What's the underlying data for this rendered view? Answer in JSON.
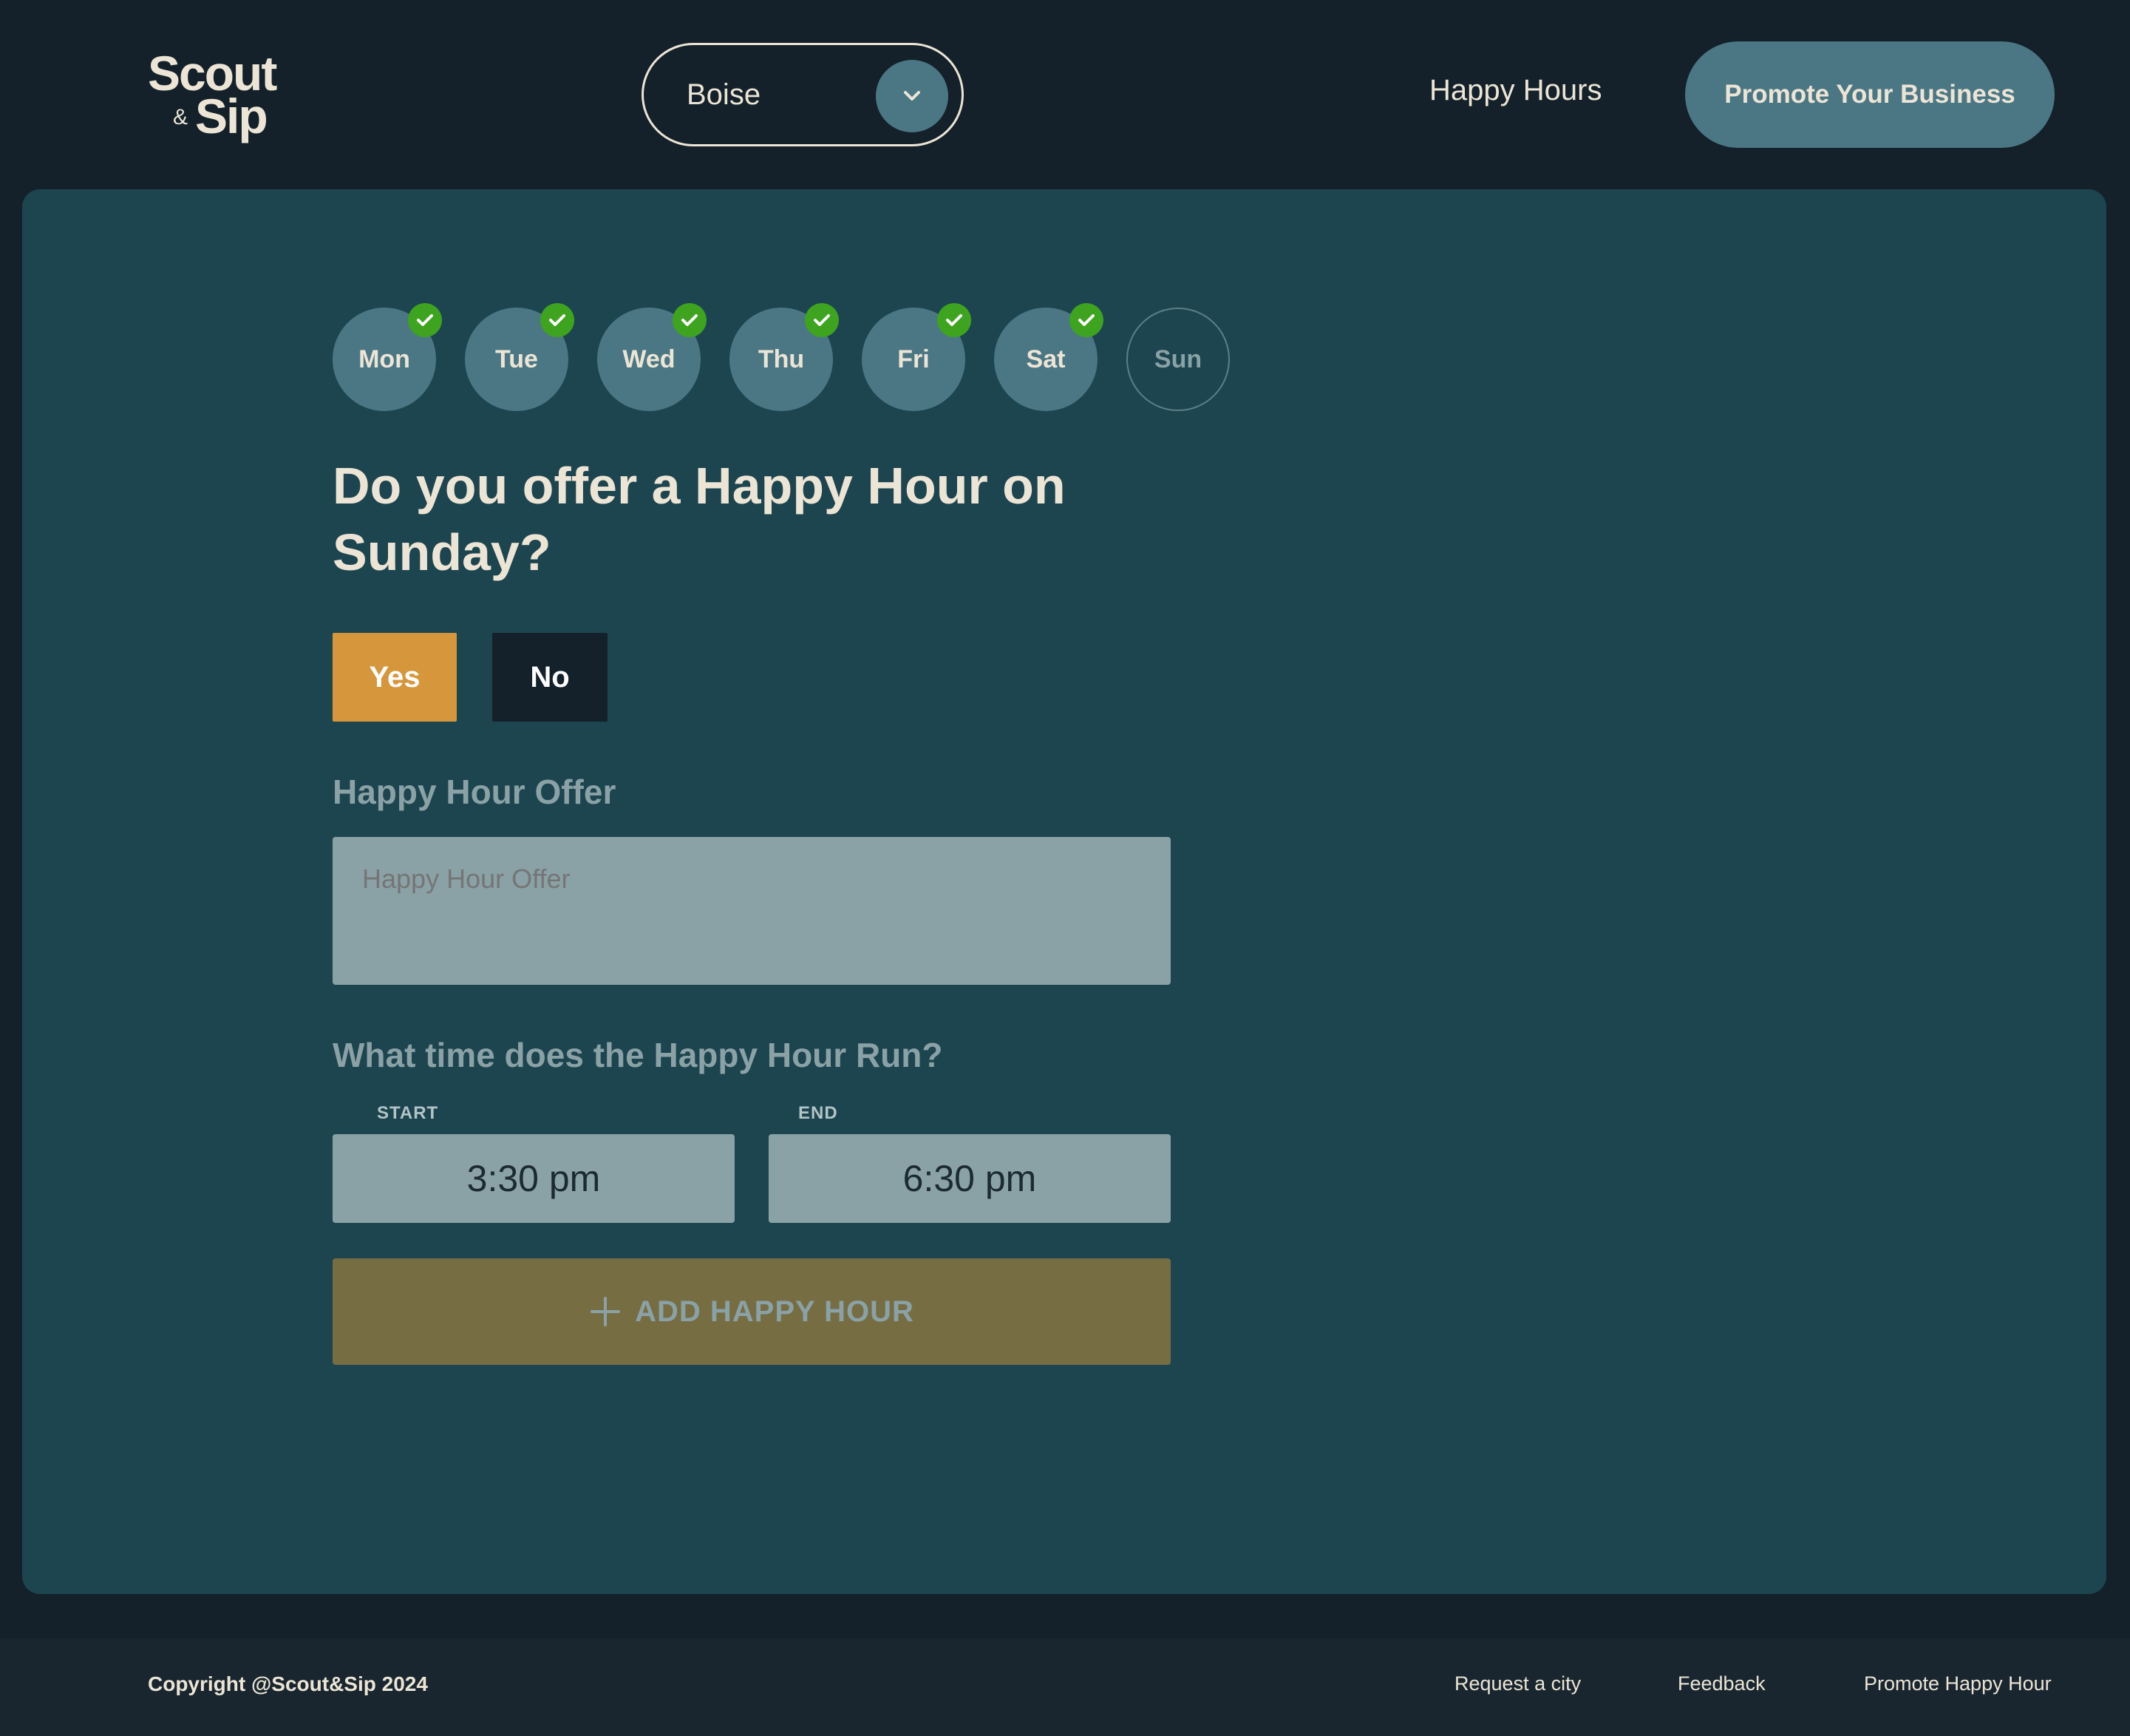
{
  "header": {
    "logo": {
      "line1": "Scout",
      "amp": "&",
      "line2": "Sip"
    },
    "city_select": {
      "value": "Boise",
      "icon": "chevron-down-icon"
    },
    "nav_link": "Happy Hours",
    "promote_button": "Promote Your Business"
  },
  "days": [
    {
      "label": "Mon",
      "done": true
    },
    {
      "label": "Tue",
      "done": true
    },
    {
      "label": "Wed",
      "done": true
    },
    {
      "label": "Thu",
      "done": true
    },
    {
      "label": "Fri",
      "done": true
    },
    {
      "label": "Sat",
      "done": true
    },
    {
      "label": "Sun",
      "done": false
    }
  ],
  "form": {
    "question": "Do you offer a Happy Hour on Sunday?",
    "yes_label": "Yes",
    "no_label": "No",
    "offer_label": "Happy Hour Offer",
    "offer_placeholder": "Happy Hour Offer",
    "time_label": "What time does the Happy Hour Run?",
    "start_caption": "START",
    "start_value": "3:30 pm",
    "end_caption": "END",
    "end_value": "6:30 pm",
    "add_button": "ADD HAPPY HOUR"
  },
  "footer": {
    "copyright": "Copyright @Scout&Sip 2024",
    "links": [
      "Request a city",
      "Feedback",
      "Promote Happy Hour"
    ]
  },
  "colors": {
    "page_bg": "#14212a",
    "panel_bg": "#1d4550",
    "accent_teal": "#4b7785",
    "yes_orange": "#d6973c",
    "check_green": "#3ea31e",
    "add_button_olive": "#776d43",
    "input_gray": "#8aa2a6",
    "text_cream": "#ece5d6"
  }
}
